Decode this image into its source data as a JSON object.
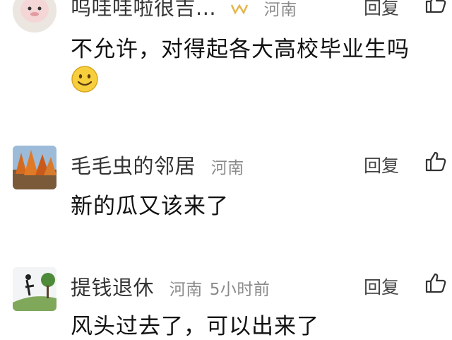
{
  "comments": [
    {
      "username": "呜哇哇啦很吉...",
      "location": "河南",
      "time": "",
      "reply_label": "回复",
      "text": "不允许，对得起各大高校毕业生吗",
      "emoji": "smiley-emoji"
    },
    {
      "username": "毛毛虫的邻居",
      "location": "河南",
      "time": "",
      "reply_label": "回复",
      "text": "新的瓜又该来了"
    },
    {
      "username": "提钱退休",
      "location": "河南",
      "time": "5小时前",
      "reply_label": "回复",
      "text": "风头过去了，可以出来了"
    }
  ],
  "icons": {
    "like": "thumbs-up-icon",
    "badge": "crown-badge-icon"
  },
  "colors": {
    "meta": "#8a8a8a",
    "text": "#111111"
  }
}
